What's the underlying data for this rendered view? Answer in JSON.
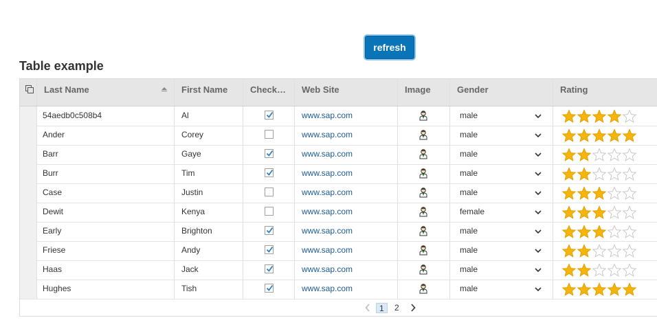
{
  "toolbar": {
    "refresh_label": "refresh"
  },
  "page": {
    "title": "Table example"
  },
  "columns": {
    "last_name": "Last Name",
    "first_name": "First Name",
    "checked": "Check…",
    "website": "Web Site",
    "image": "Image",
    "gender": "Gender",
    "rating": "Rating"
  },
  "rows": [
    {
      "last": "54aedb0c508b4",
      "first": "Al",
      "checked": true,
      "web": "www.sap.com",
      "gender": "male",
      "rating": 4
    },
    {
      "last": "Ander",
      "first": "Corey",
      "checked": false,
      "web": "www.sap.com",
      "gender": "male",
      "rating": 5
    },
    {
      "last": "Barr",
      "first": "Gaye",
      "checked": true,
      "web": "www.sap.com",
      "gender": "male",
      "rating": 2
    },
    {
      "last": "Burr",
      "first": "Tim",
      "checked": true,
      "web": "www.sap.com",
      "gender": "male",
      "rating": 2
    },
    {
      "last": "Case",
      "first": "Justin",
      "checked": false,
      "web": "www.sap.com",
      "gender": "male",
      "rating": 3
    },
    {
      "last": "Dewit",
      "first": "Kenya",
      "checked": false,
      "web": "www.sap.com",
      "gender": "female",
      "rating": 3
    },
    {
      "last": "Early",
      "first": "Brighton",
      "checked": true,
      "web": "www.sap.com",
      "gender": "male",
      "rating": 3
    },
    {
      "last": "Friese",
      "first": "Andy",
      "checked": true,
      "web": "www.sap.com",
      "gender": "male",
      "rating": 2
    },
    {
      "last": "Haas",
      "first": "Jack",
      "checked": true,
      "web": "www.sap.com",
      "gender": "male",
      "rating": 2
    },
    {
      "last": "Hughes",
      "first": "Tish",
      "checked": true,
      "web": "www.sap.com",
      "gender": "male",
      "rating": 5
    }
  ],
  "rating_max": 5,
  "pager": {
    "pages": [
      "1",
      "2"
    ],
    "current": "1"
  },
  "icons": {
    "select_all": "select-all-icon",
    "sort": "sort-ascending-icon",
    "image": "person-icon",
    "gender_dropdown": "chevron-down-icon",
    "rating": "star-icon",
    "prev": "chevron-left-icon",
    "next": "chevron-right-icon"
  },
  "colors": {
    "accent": "#0a74b8",
    "star_filled": "#f5b50b",
    "star_empty": "#ffffff",
    "link": "#1d5a95",
    "header_bg": "#e6e6e6",
    "checkmark": "#2e7fbf"
  }
}
